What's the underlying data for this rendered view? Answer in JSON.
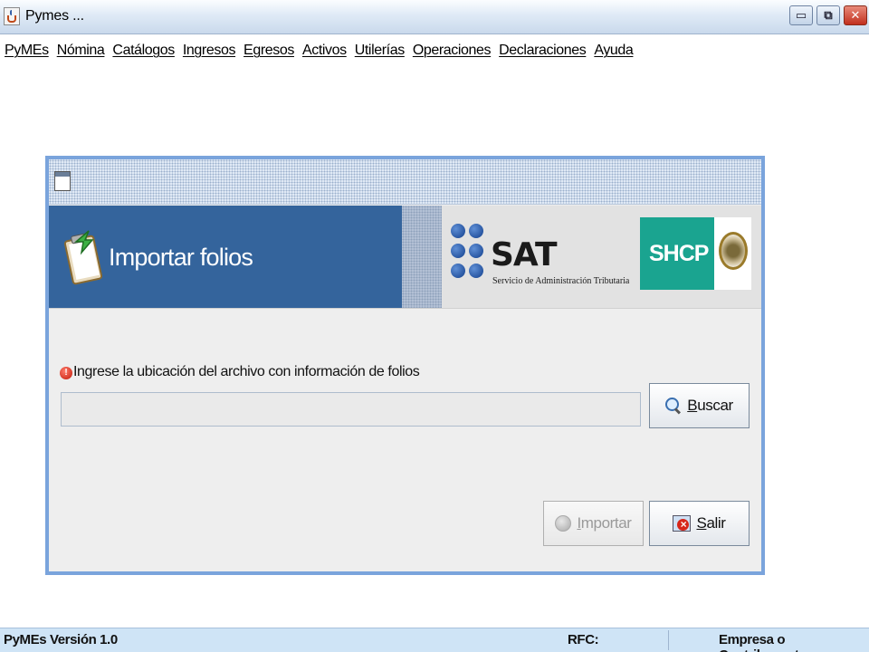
{
  "window": {
    "title": "Pymes ...",
    "controls": {
      "minimize": "▭",
      "maximize": "⧉",
      "close": "✕"
    }
  },
  "menu": {
    "items": [
      {
        "label": "PyMEs"
      },
      {
        "label": "Nómina"
      },
      {
        "label": "Catálogos"
      },
      {
        "label": "Ingresos"
      },
      {
        "label": "Egresos"
      },
      {
        "label": "Activos"
      },
      {
        "label": "Utilerías"
      },
      {
        "label": "Operaciones"
      },
      {
        "label": "Declaraciones"
      },
      {
        "label": "Ayuda"
      }
    ]
  },
  "dialog": {
    "banner": {
      "title": "Importar folios",
      "sat_logo": "SAT",
      "sat_subtitle": "Servicio de Administración Tributaria",
      "shcp_logo": "SHCP"
    },
    "prompt": "Ingrese la ubicación del archivo con información de folios",
    "path_value": "",
    "buttons": {
      "buscar": {
        "prefix": "",
        "accel": "B",
        "rest": "uscar",
        "icon": "magnifier-icon"
      },
      "importar": {
        "prefix": "",
        "accel": "I",
        "rest": "mportar",
        "icon": "import-icon",
        "enabled": false
      },
      "salir": {
        "prefix": "",
        "accel": "S",
        "rest": "alir",
        "icon": "exit-icon"
      }
    }
  },
  "status": {
    "version": "PyMEs Versión 1.0",
    "rfc_label": "RFC:",
    "empresa_label": "Empresa o Contribuyente:"
  },
  "colors": {
    "banner_blue": "#34649c",
    "frame_border": "#7aa4dc",
    "shcp_green": "#1aa490",
    "status_bg": "#cfe4f6"
  }
}
